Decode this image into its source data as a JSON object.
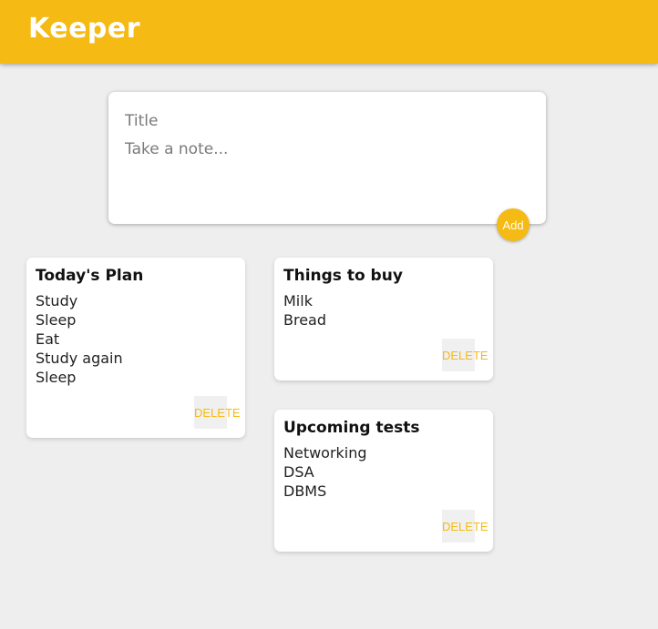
{
  "app": {
    "title": "Keeper",
    "accent_color": "#f5ba13",
    "background_color": "#eeeeee"
  },
  "create_area": {
    "title_placeholder": "Title",
    "title_value": "",
    "content_placeholder": "Take a note...",
    "content_value": "",
    "add_label": "Add"
  },
  "notes": [
    {
      "title": "Today's Plan",
      "content": "Study\nSleep\nEat\nStudy again\nSleep",
      "delete_label": "DELETE"
    },
    {
      "title": "Things to buy",
      "content": "Milk\nBread",
      "delete_label": "DELETE"
    },
    {
      "title": "Upcoming tests",
      "content": "Networking\nDSA\nDBMS",
      "delete_label": "DELETE"
    }
  ]
}
